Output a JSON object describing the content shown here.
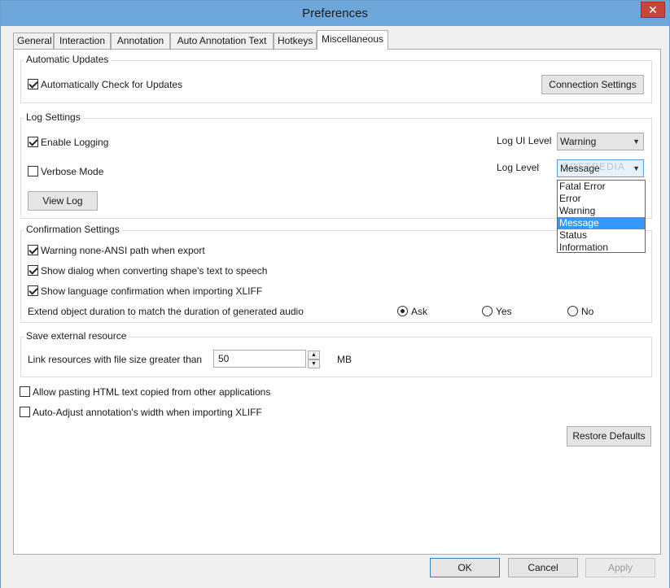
{
  "window": {
    "title": "Preferences",
    "close_glyph": "✕"
  },
  "tabs": [
    {
      "label": "General"
    },
    {
      "label": "Interaction"
    },
    {
      "label": "Annotation"
    },
    {
      "label": "Auto Annotation Text"
    },
    {
      "label": "Hotkeys"
    },
    {
      "label": "Miscellaneous"
    }
  ],
  "active_tab": "Miscellaneous",
  "automatic_updates": {
    "title": "Automatic Updates",
    "auto_check_label": "Automatically Check for Updates",
    "auto_check": true,
    "connection_settings_label": "Connection Settings"
  },
  "log_settings": {
    "title": "Log Settings",
    "enable_logging_label": "Enable Logging",
    "enable_logging": true,
    "verbose_label": "Verbose Mode",
    "verbose": false,
    "view_log_label": "View Log",
    "log_ui_level_label": "Log UI Level",
    "log_ui_level_value": "Warning",
    "log_level_label": "Log Level",
    "log_level_value": "Message",
    "log_level_options": [
      "Fatal Error",
      "Error",
      "Warning",
      "Message",
      "Status",
      "Information"
    ],
    "log_level_selected_index": 3
  },
  "confirmation": {
    "title": "Confirmation Settings",
    "items": [
      {
        "label": "Warning none-ANSI path when export",
        "checked": true
      },
      {
        "label": "Show dialog when converting shape's text to speech",
        "checked": true
      },
      {
        "label": "Show language confirmation when importing XLIFF",
        "checked": true
      }
    ],
    "extend_label": "Extend object duration to match the duration of generated audio",
    "extend_options": [
      "Ask",
      "Yes",
      "No"
    ],
    "extend_selected": "Ask"
  },
  "external_resource": {
    "title": "Save external resource",
    "link_label": "Link resources with file size greater than",
    "size_value": "50",
    "unit": "MB"
  },
  "misc": {
    "allow_html_label": "Allow pasting HTML text copied from other applications",
    "allow_html": false,
    "auto_adjust_label": "Auto-Adjust annotation's width when importing XLIFF",
    "auto_adjust": false,
    "restore_defaults_label": "Restore Defaults"
  },
  "footer": {
    "ok_label": "OK",
    "cancel_label": "Cancel",
    "apply_label": "Apply"
  },
  "watermark": "SOFTPEDIA",
  "colors": {
    "titlebar": "#6ca6db",
    "close": "#c7463c",
    "selection": "#3399ff"
  }
}
